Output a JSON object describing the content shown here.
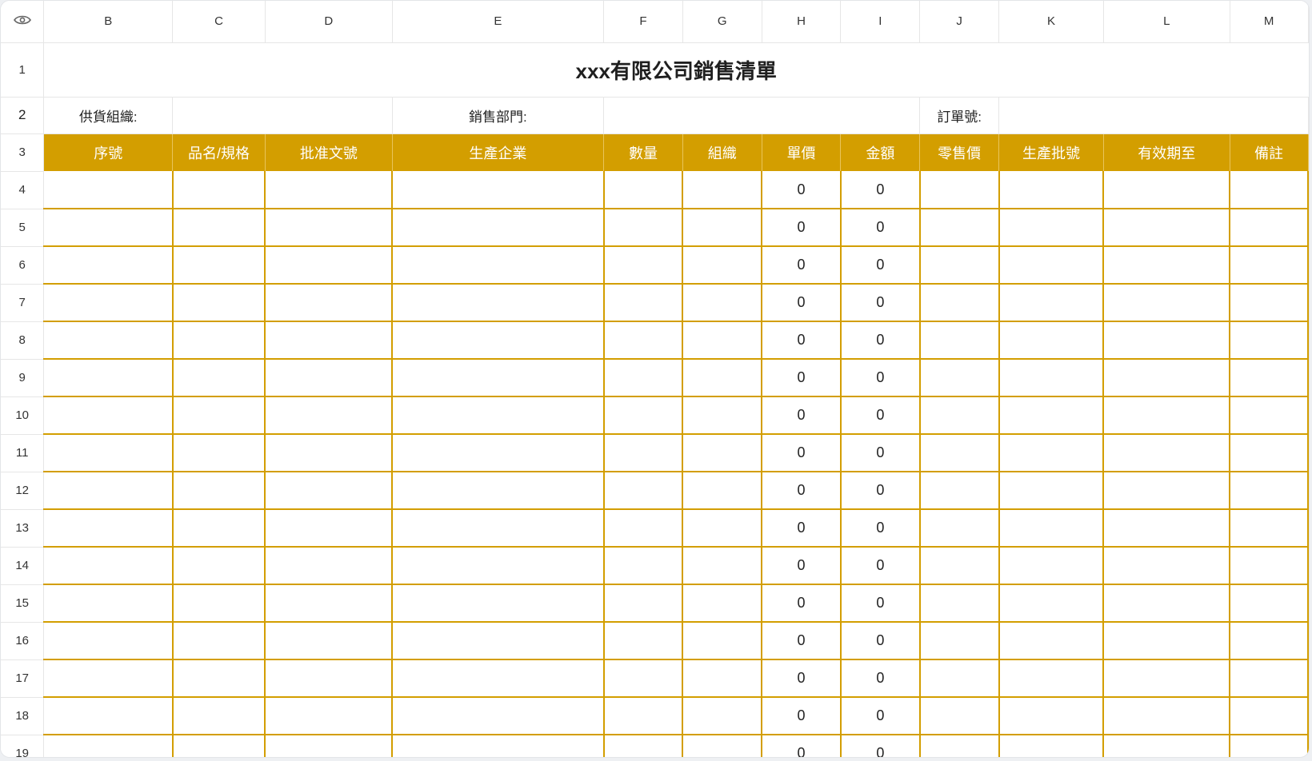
{
  "columns": [
    "B",
    "C",
    "D",
    "E",
    "F",
    "G",
    "H",
    "I",
    "J",
    "K",
    "L",
    "M"
  ],
  "title": "xxx有限公司銷售清單",
  "info_row": {
    "supplier_label": "供貨組織:",
    "dept_label": "銷售部門:",
    "order_label": "訂單號:"
  },
  "headers": [
    "序號",
    "品名/規格",
    "批准文號",
    "生產企業",
    "數量",
    "組織",
    "單價",
    "金額",
    "零售價",
    "生產批號",
    "有效期至",
    "備註"
  ],
  "row_numbers": [
    "1",
    "2",
    "3",
    "4",
    "5",
    "6",
    "7",
    "8",
    "9",
    "10",
    "11",
    "12",
    "13",
    "14",
    "15",
    "16",
    "17",
    "18",
    "19"
  ],
  "data_rows": [
    {
      "h": "0",
      "i": "0"
    },
    {
      "h": "0",
      "i": "0"
    },
    {
      "h": "0",
      "i": "0"
    },
    {
      "h": "0",
      "i": "0"
    },
    {
      "h": "0",
      "i": "0"
    },
    {
      "h": "0",
      "i": "0"
    },
    {
      "h": "0",
      "i": "0"
    },
    {
      "h": "0",
      "i": "0"
    },
    {
      "h": "0",
      "i": "0"
    },
    {
      "h": "0",
      "i": "0"
    },
    {
      "h": "0",
      "i": "0"
    },
    {
      "h": "0",
      "i": "0"
    },
    {
      "h": "0",
      "i": "0"
    },
    {
      "h": "0",
      "i": "0"
    },
    {
      "h": "0",
      "i": "0"
    },
    {
      "h": "0",
      "i": "0"
    }
  ],
  "icons": {
    "corner": "eye-icon"
  },
  "colors": {
    "header_bg": "#d39e00",
    "grid": "#d39e00"
  }
}
